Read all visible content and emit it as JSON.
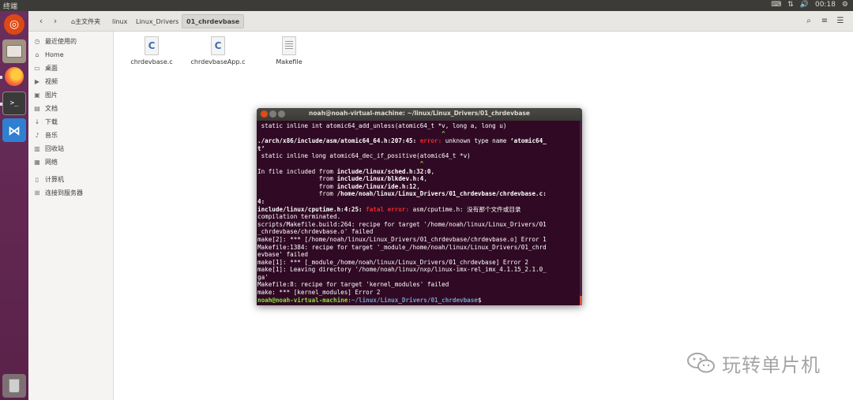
{
  "top_panel": {
    "title": "终端",
    "time": "00:18"
  },
  "launcher": {
    "items": [
      "ubuntu-dash",
      "files",
      "firefox",
      "terminal",
      "vscode",
      "trash"
    ]
  },
  "files": {
    "breadcrumbs": [
      "主文件夹",
      "linux",
      "Linux_Drivers",
      "01_chrdevbase"
    ],
    "sidebar": [
      {
        "icon": "clock-icon",
        "label": "最近使用的"
      },
      {
        "icon": "home-icon",
        "label": "Home"
      },
      {
        "icon": "desktop-icon",
        "label": "桌面"
      },
      {
        "icon": "video-icon",
        "label": "视频"
      },
      {
        "icon": "picture-icon",
        "label": "图片"
      },
      {
        "icon": "document-icon",
        "label": "文档"
      },
      {
        "icon": "download-icon",
        "label": "下载"
      },
      {
        "icon": "music-icon",
        "label": "音乐"
      },
      {
        "icon": "trash-icon",
        "label": "回收站"
      },
      {
        "icon": "network-icon",
        "label": "网络"
      },
      {
        "icon": "computer-icon",
        "label": "计算机"
      },
      {
        "icon": "server-icon",
        "label": "连接到服务器"
      }
    ],
    "items": [
      {
        "name": "chrdevbase.c",
        "type": "c-source"
      },
      {
        "name": "chrdevbaseApp.c",
        "type": "c-source"
      },
      {
        "name": "Makefile",
        "type": "text"
      }
    ]
  },
  "terminal": {
    "title": "noah@noah-virtual-machine: ~/linux/Linux_Drivers/01_chrdevbase",
    "lines": {
      "l1": " static inline int atomic64_add_unless(atomic64_t *v, long a, long u)",
      "l2": "                                                   ^",
      "l3a": "./arch/x86/include/asm/atomic64_64.h:207:45: ",
      "l3b": "error: ",
      "l3c": "unknown type name ",
      "l3d": "‘atomic64_",
      "l4": "t’",
      "l5": " static inline long atomic64_dec_if_positive(atomic64_t *v)",
      "l6": "                                             ^",
      "l7a": "In file included from ",
      "l7b": "include/linux/sched.h:32:0",
      "l7c": ",",
      "l8a": "                 from ",
      "l8b": "include/linux/blkdev.h:4",
      "l8c": ",",
      "l9a": "                 from ",
      "l9b": "include/linux/ide.h:12",
      "l9c": ",",
      "l10a": "                 from ",
      "l10b": "/home/noah/linux/Linux_Drivers/01_chrdevbase/chrdevbase.c:",
      "l11": "4:",
      "l12a": "include/linux/cputime.h:4:25: ",
      "l12b": "fatal error: ",
      "l12c": "asm/cputime.h: 没有那个文件或目录",
      "l13": "compilation terminated.",
      "l14": "scripts/Makefile.build:264: recipe for target '/home/noah/linux/Linux_Drivers/01",
      "l15": "_chrdevbase/chrdevbase.o' failed",
      "l16": "make[2]: *** [/home/noah/linux/Linux_Drivers/01_chrdevbase/chrdevbase.o] Error 1",
      "l17": "Makefile:1384: recipe for target '_module_/home/noah/linux/Linux_Drivers/01_chrd",
      "l18": "evbase' failed",
      "l19": "make[1]: *** [_module_/home/noah/linux/Linux_Drivers/01_chrdevbase] Error 2",
      "l20": "make[1]: Leaving directory '/home/noah/linux/nxp/linux-imx-rel_imx_4.1.15_2.1.0_",
      "l21": "ga'",
      "l22": "Makefile:8: recipe for target 'kernel_modules' failed",
      "l23": "make: *** [kernel_modules] Error 2",
      "prompt_user": "noah@noah-virtual-machine",
      "prompt_path": ":~/linux/Linux_Drivers/01_chrdevbase",
      "prompt_end": "$ "
    }
  },
  "watermark": {
    "text": "玩转单片机"
  },
  "colors": {
    "launcher": "#5e2750",
    "terminal_bg": "#300a24",
    "error": "#ef2929",
    "prompt_user": "#8ae234",
    "prompt_path": "#729fcf"
  }
}
